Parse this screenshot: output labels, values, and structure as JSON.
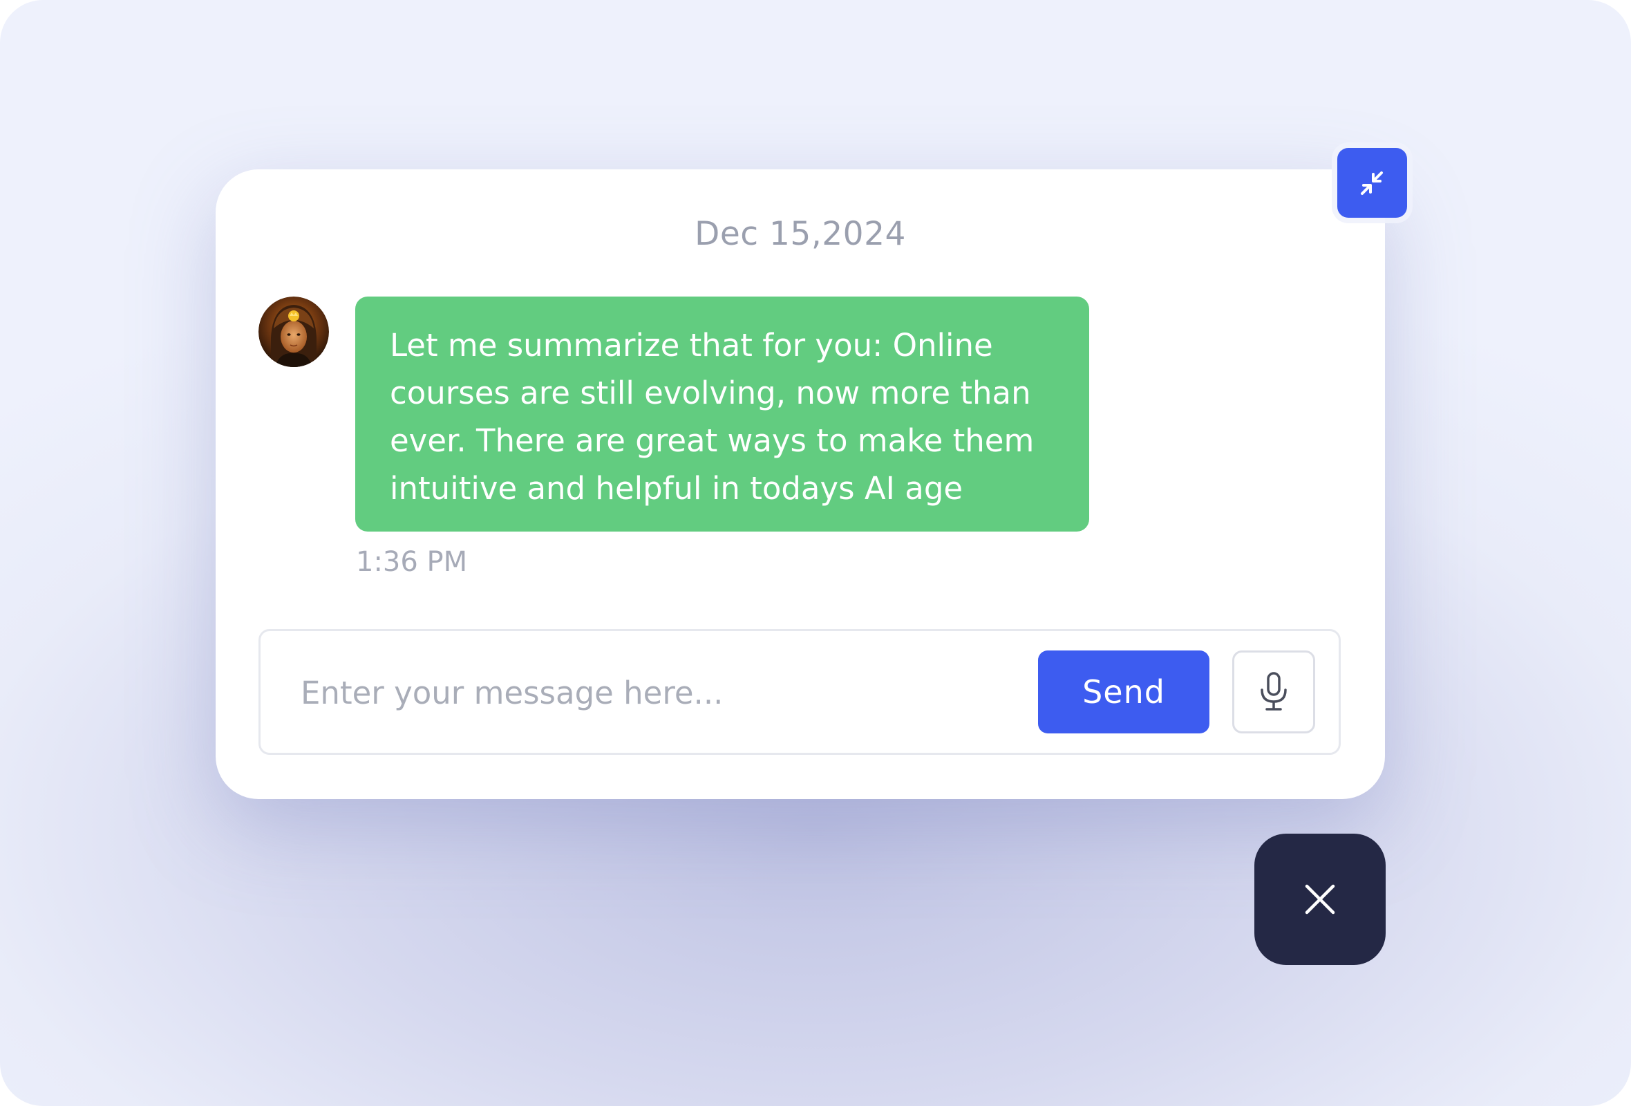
{
  "chat": {
    "date": "Dec 15,2024",
    "messages": [
      {
        "sender": "assistant",
        "text": "Let me summarize that for you: Online courses are still evolving, now more than ever. There are great ways to make them intuitive and helpful in todays AI age",
        "time": "1:36 PM"
      }
    ]
  },
  "composer": {
    "placeholder": "Enter your message here...",
    "value": "",
    "send_label": "Send"
  },
  "icons": {
    "minimize": "minimize-arrows-icon",
    "close": "close-icon",
    "mic": "microphone-icon",
    "avatar": "assistant-avatar"
  },
  "colors": {
    "accent": "#3d5cf0",
    "bubble": "#62cc80",
    "fab": "#242845"
  }
}
